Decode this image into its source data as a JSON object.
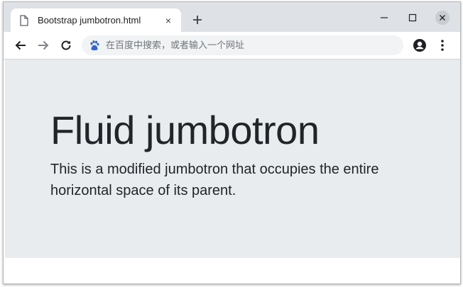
{
  "browser": {
    "tab_title": "Bootstrap jumbotron.html",
    "tab_close_glyph": "×",
    "new_tab_glyph": "+",
    "omnibox_placeholder": "在百度中搜索，或者输入一个网址",
    "icons": [
      "file-icon",
      "close-icon",
      "plus-icon",
      "minimize-icon",
      "maximize-icon",
      "window-close-icon",
      "back-arrow-icon",
      "forward-arrow-icon",
      "reload-icon",
      "baidu-paw-icon",
      "profile-icon",
      "kebab-menu-icon"
    ]
  },
  "page": {
    "jumbotron": {
      "title": "Fluid jumbotron",
      "lead": "This is a modified jumbotron that occupies the entire horizontal space of its parent.",
      "background": "#e9ecef",
      "text_color": "#212529"
    }
  },
  "colors": {
    "tabstrip": "#dee1e6",
    "omnibox": "#f1f3f4",
    "baidu_blue": "#3366cc"
  }
}
